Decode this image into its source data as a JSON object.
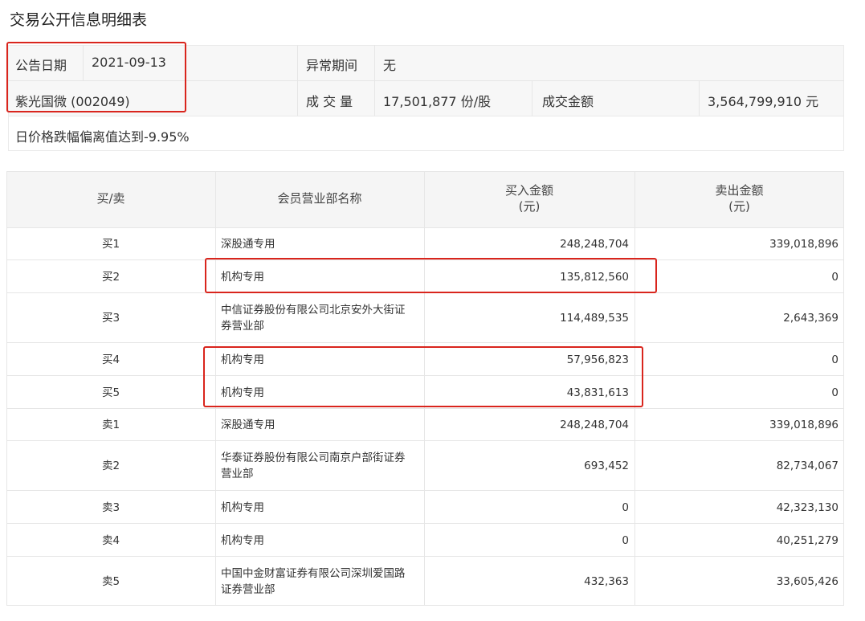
{
  "title": "交易公开信息明细表",
  "info": {
    "date_label": "公告日期",
    "date_value": "2021-09-13",
    "abnormal_label": "异常期间",
    "abnormal_value": "无",
    "stock_name": "紫光国微 (002049)",
    "volume_label": "成 交 量",
    "volume_value": "17,501,877 份/股",
    "amount_label": "成交金额",
    "amount_value": "3,564,799,910 元",
    "reason": "日价格跌幅偏离值达到-9.95%"
  },
  "table": {
    "headers": [
      "买/卖",
      "会员营业部名称",
      "买入金额\n(元)",
      "卖出金额\n(元)"
    ],
    "header_buy_line1": "买入金额",
    "header_buy_line2": "(元)",
    "header_sell_line1": "卖出金额",
    "header_sell_line2": "(元)",
    "rows": [
      {
        "side": "买1",
        "name": "深股通专用",
        "name2": "",
        "buy": "248,248,704",
        "sell": "339,018,896"
      },
      {
        "side": "买2",
        "name": "机构专用",
        "name2": "",
        "buy": "135,812,560",
        "sell": "0"
      },
      {
        "side": "买3",
        "name": "中信证券股份有限公司北京安外大街证",
        "name2": "券营业部",
        "buy": "114,489,535",
        "sell": "2,643,369"
      },
      {
        "side": "买4",
        "name": "机构专用",
        "name2": "",
        "buy": "57,956,823",
        "sell": "0"
      },
      {
        "side": "买5",
        "name": "机构专用",
        "name2": "",
        "buy": "43,831,613",
        "sell": "0"
      },
      {
        "side": "卖1",
        "name": "深股通专用",
        "name2": "",
        "buy": "248,248,704",
        "sell": "339,018,896"
      },
      {
        "side": "卖2",
        "name": "华泰证券股份有限公司南京户部街证券",
        "name2": "营业部",
        "buy": "693,452",
        "sell": "82,734,067"
      },
      {
        "side": "卖3",
        "name": "机构专用",
        "name2": "",
        "buy": "0",
        "sell": "42,323,130"
      },
      {
        "side": "卖4",
        "name": "机构专用",
        "name2": "",
        "buy": "0",
        "sell": "40,251,279"
      },
      {
        "side": "卖5",
        "name": "中国中金财富证券有限公司深圳爱国路",
        "name2": "证券营业部",
        "buy": "432,363",
        "sell": "33,605,426"
      }
    ]
  },
  "colors": {
    "highlight": "#d9251d",
    "header_bg": "#f5f5f5",
    "grid": "#e6e6e6"
  }
}
